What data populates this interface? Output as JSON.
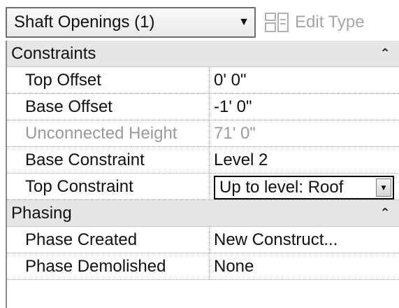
{
  "properties_panel": {
    "type_selector": {
      "label": "Shaft Openings (1)"
    },
    "edit_type": {
      "label": "Edit Type"
    },
    "groups": [
      {
        "title": "Constraints",
        "rows": [
          {
            "name": "Top Offset",
            "value": "0'  0\""
          },
          {
            "name": "Base Offset",
            "value": "-1'  0\""
          },
          {
            "name": "Unconnected Height",
            "value": "71'  0\""
          },
          {
            "name": "Base Constraint",
            "value": "Level 2"
          },
          {
            "name": "Top Constraint",
            "value": "Up to level: Roof"
          }
        ]
      },
      {
        "title": "Phasing",
        "rows": [
          {
            "name": "Phase Created",
            "value": "New Construct..."
          },
          {
            "name": "Phase Demolished",
            "value": "None"
          }
        ]
      }
    ]
  }
}
